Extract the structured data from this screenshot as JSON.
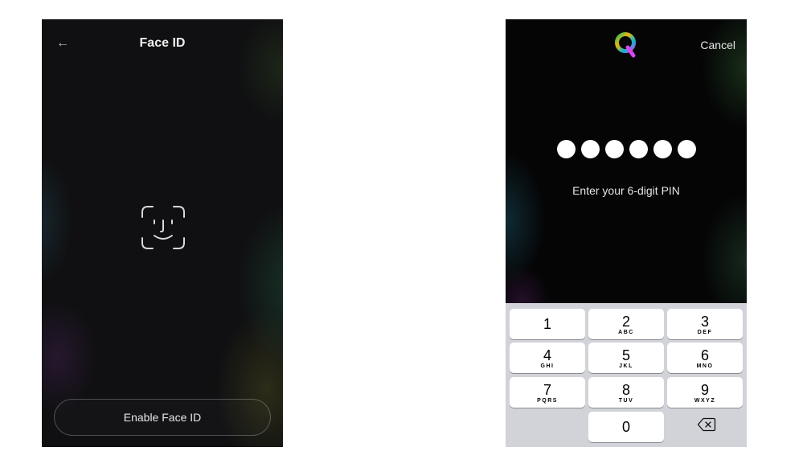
{
  "face_id_screen": {
    "back_label": "←",
    "title": "Face ID",
    "face_icon": "face-id-icon",
    "enable_button_label": "Enable Face ID"
  },
  "pin_screen": {
    "logo_icon": "q-logo-icon",
    "cancel_label": "Cancel",
    "pin_entered_count": 6,
    "pin_length": 6,
    "prompt": "Enter your 6-digit PIN",
    "keypad": {
      "keys": [
        {
          "digit": "1",
          "letters": ""
        },
        {
          "digit": "2",
          "letters": "ABC"
        },
        {
          "digit": "3",
          "letters": "DEF"
        },
        {
          "digit": "4",
          "letters": "GHI"
        },
        {
          "digit": "5",
          "letters": "JKL"
        },
        {
          "digit": "6",
          "letters": "MNO"
        },
        {
          "digit": "7",
          "letters": "PQRS"
        },
        {
          "digit": "8",
          "letters": "TUV"
        },
        {
          "digit": "9",
          "letters": "WXYZ"
        },
        {
          "digit": "0",
          "letters": ""
        }
      ],
      "backspace_icon": "backspace-icon"
    }
  },
  "colors": {
    "screen_background": "#0b0b0c",
    "keypad_background": "#d1d3d9",
    "key_background": "#ffffff"
  }
}
